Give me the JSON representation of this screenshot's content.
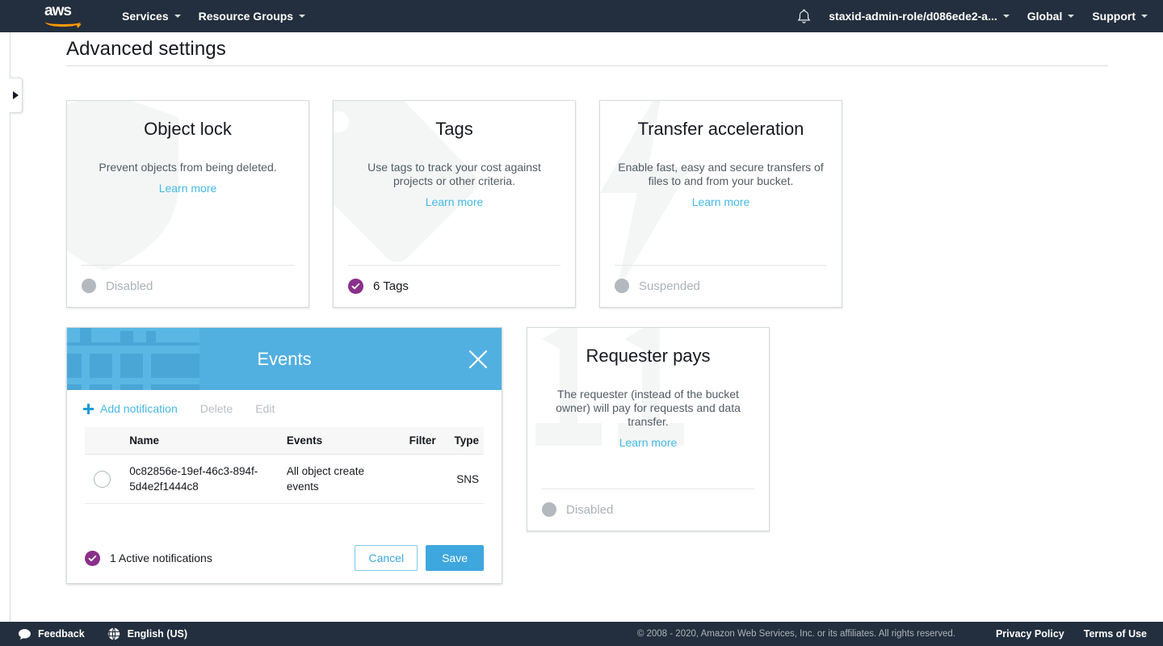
{
  "topnav": {
    "logo_alt": "aws",
    "items": [
      {
        "label": "Services",
        "caret": true
      },
      {
        "label": "Resource Groups",
        "caret": true
      }
    ],
    "bell_icon": "bell-icon",
    "account": "staxid-admin-role/d086ede2-a...",
    "region": "Global",
    "support": "Support"
  },
  "page": {
    "title": "Advanced settings"
  },
  "cards": [
    {
      "id": "object-lock",
      "title": "Object lock",
      "description": "Prevent objects from being deleted.",
      "learn_more": "Learn more",
      "status": "Disabled",
      "status_state": "off",
      "watermark": "shield-icon"
    },
    {
      "id": "tags",
      "title": "Tags",
      "description": "Use tags to track your cost against projects or other criteria.",
      "learn_more": "Learn more",
      "status": "6 Tags",
      "status_state": "on",
      "watermark": "tag-icon"
    },
    {
      "id": "transfer-acceleration",
      "title": "Transfer acceleration",
      "description": "Enable fast, easy and secure transfers of files to and from your bucket.",
      "learn_more": "Learn more",
      "status": "Suspended",
      "status_state": "off",
      "watermark": "lightning-bolt-icon"
    },
    {
      "id": "requester-pays",
      "title": "Requester pays",
      "description": "The requester (instead of the bucket owner) will pay for requests and data transfer.",
      "learn_more": "Learn more",
      "status": "Disabled",
      "status_state": "off",
      "watermark": "dollar-icon"
    }
  ],
  "events_panel": {
    "title": "Events",
    "close_icon": "close-icon",
    "watermark": "building-grid-icon",
    "toolbar": {
      "add_label": "Add notification",
      "delete_label": "Delete",
      "edit_label": "Edit"
    },
    "table": {
      "columns": [
        "Name",
        "Events",
        "Filter",
        "Type"
      ],
      "rows": [
        {
          "name": "0c82856e-19ef-46c3-894f-5d4e2f1444c8",
          "events": "All object create events",
          "filter": "",
          "type": "SNS"
        }
      ]
    },
    "footer": {
      "status": "1 Active notifications",
      "status_state": "on",
      "cancel_label": "Cancel",
      "save_label": "Save"
    }
  },
  "bottombar": {
    "feedback": "Feedback",
    "language": "English (US)",
    "copyright": "© 2008 - 2020, Amazon Web Services, Inc. or its affiliates. All rights reserved.",
    "privacy": "Privacy Policy",
    "terms": "Terms of Use"
  },
  "colors": {
    "nav_bg": "#232f3e",
    "accent_orange": "#ff9900",
    "link_blue": "#44b9e6",
    "panel_header_blue": "#51b0e0",
    "status_purple": "#8b2f8b",
    "status_grey": "#b4b9bf"
  }
}
